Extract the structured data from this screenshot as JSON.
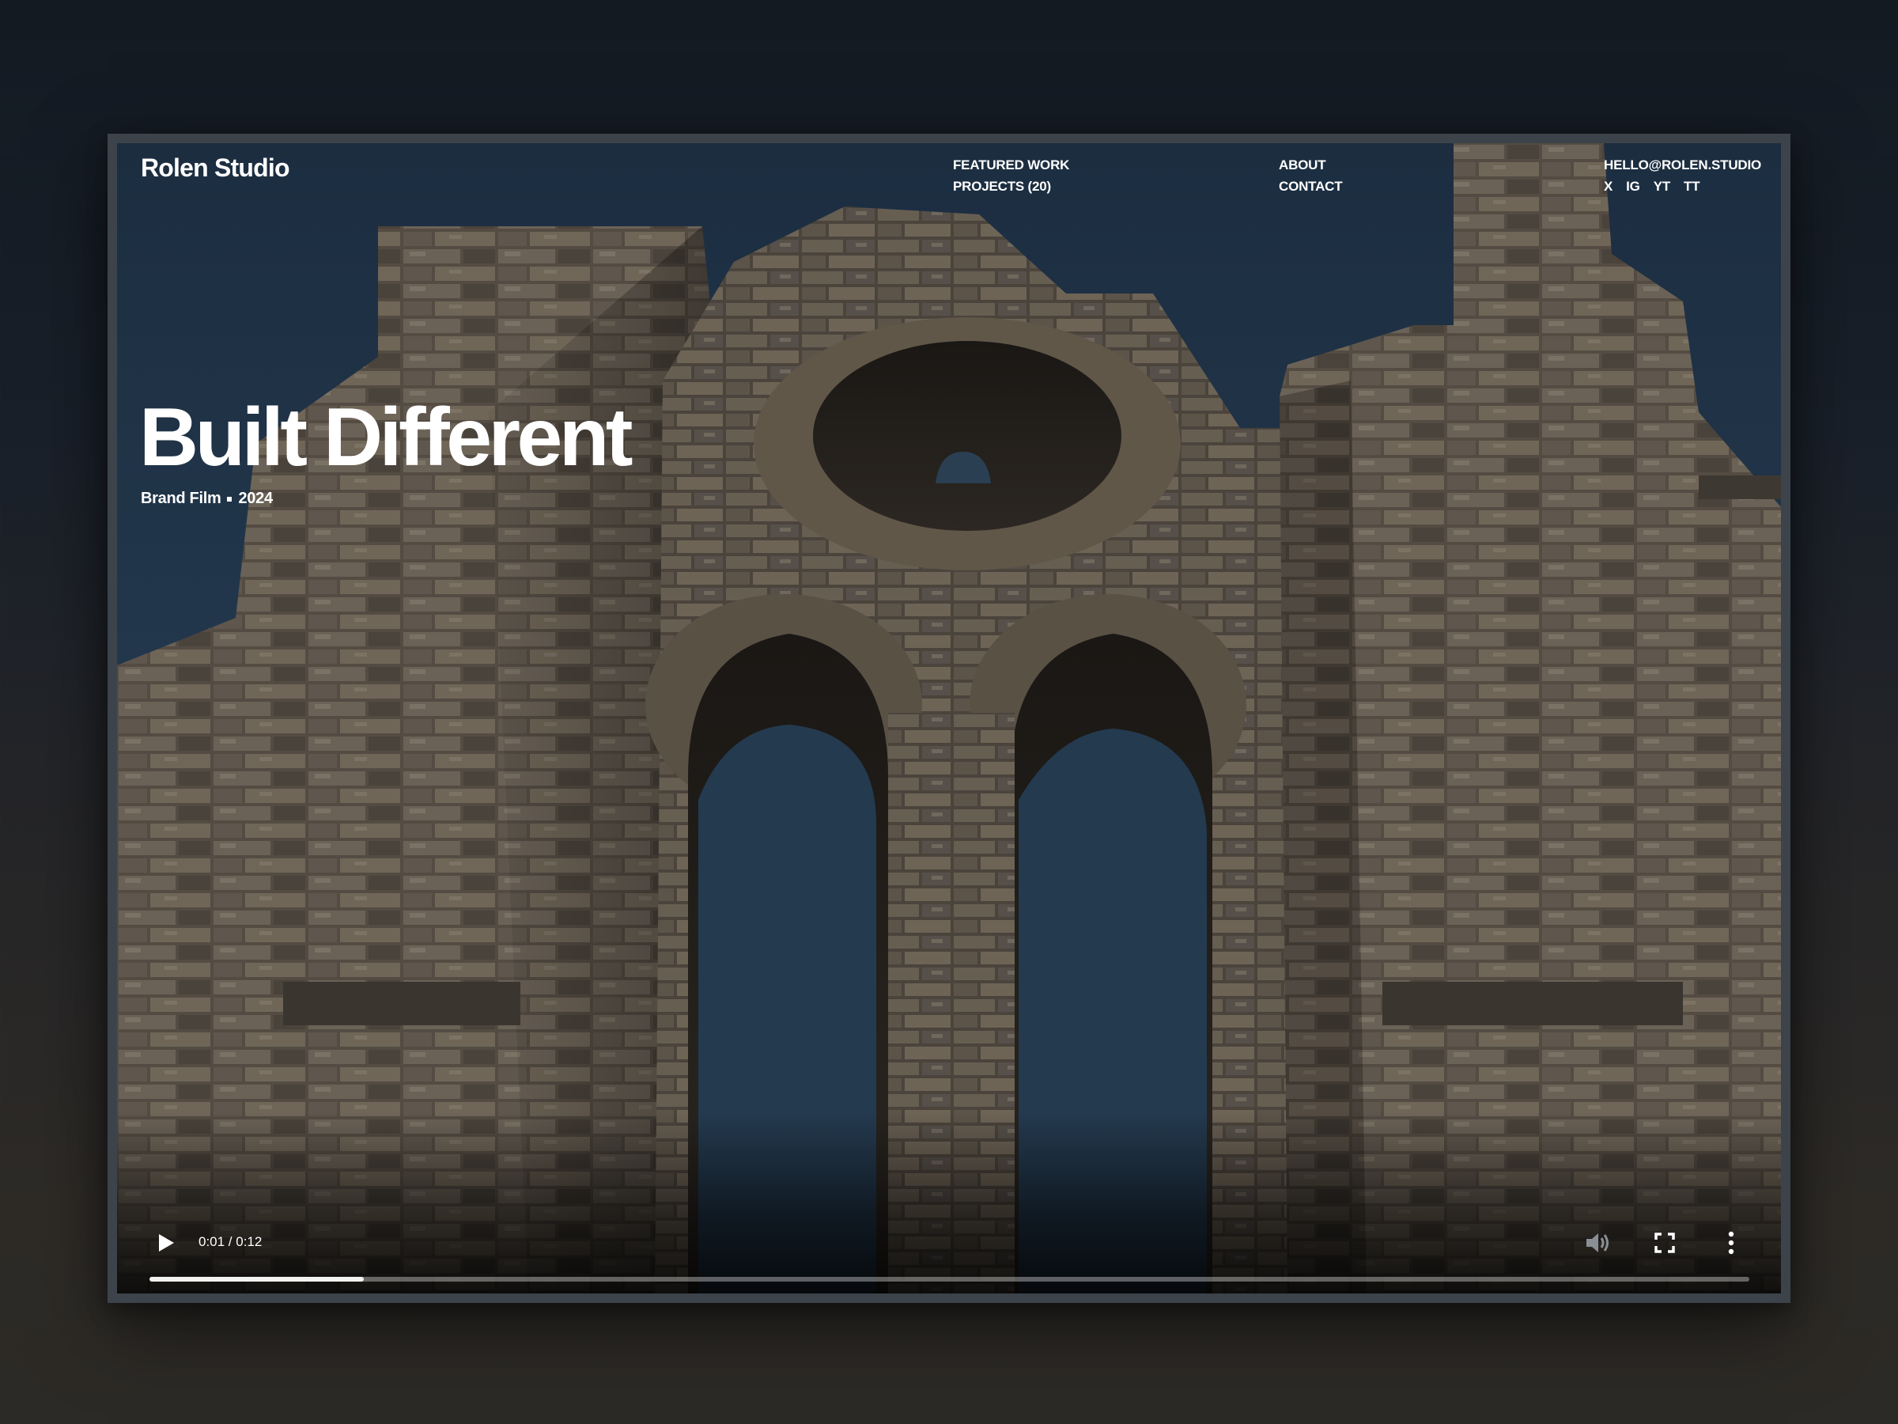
{
  "header": {
    "brand": "Rolen Studio",
    "nav": {
      "featured_work": "FEATURED WORK",
      "projects": "PROJECTS (20)",
      "about": "ABOUT",
      "contact": "CONTACT",
      "email": "HELLO@ROLEN.STUDIO",
      "socials": [
        "X",
        "IG",
        "YT",
        "TT"
      ]
    }
  },
  "hero": {
    "title": "Built Different",
    "category": "Brand Film",
    "year": "2024"
  },
  "video": {
    "time": "0:01 / 0:12",
    "progress": 0.134,
    "icons": {
      "play": "play-icon",
      "volume": "volume-icon",
      "fullscreen": "fullscreen-icon",
      "menu": "more-vertical-icon"
    }
  },
  "colors": {
    "sky": "#22374c",
    "stone": "#5b5349",
    "text": "#ffffff",
    "frame": "#3c434a"
  }
}
